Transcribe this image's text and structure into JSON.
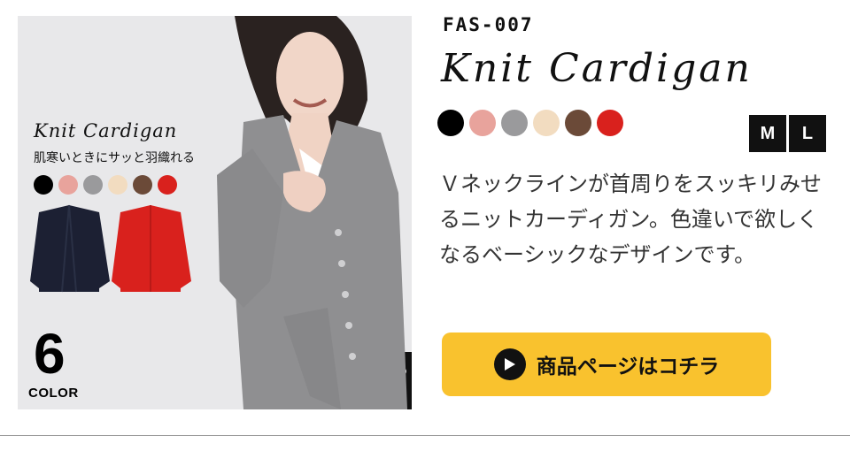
{
  "product": {
    "code": "FAS-007",
    "title": "Knit Cardigan",
    "swatches": [
      "#000000",
      "#e8a39c",
      "#9a9a9c",
      "#f2dcc0",
      "#6b4a38",
      "#d9211d"
    ],
    "sizes": [
      "M",
      "L"
    ],
    "description": "Ｖネックラインが首周りをスッキリみせるニットカーディガン。色違いで欲しくなるベーシックなデザインです。",
    "cta_label": "商品ページはコチラ"
  },
  "photo": {
    "inset_title": "Knit Cardigan",
    "inset_subtitle": "肌寒いときにサッと羽織れる",
    "color_count": "6",
    "color_label": "COLOR"
  },
  "icons": {
    "cta": "play-circle-icon"
  }
}
